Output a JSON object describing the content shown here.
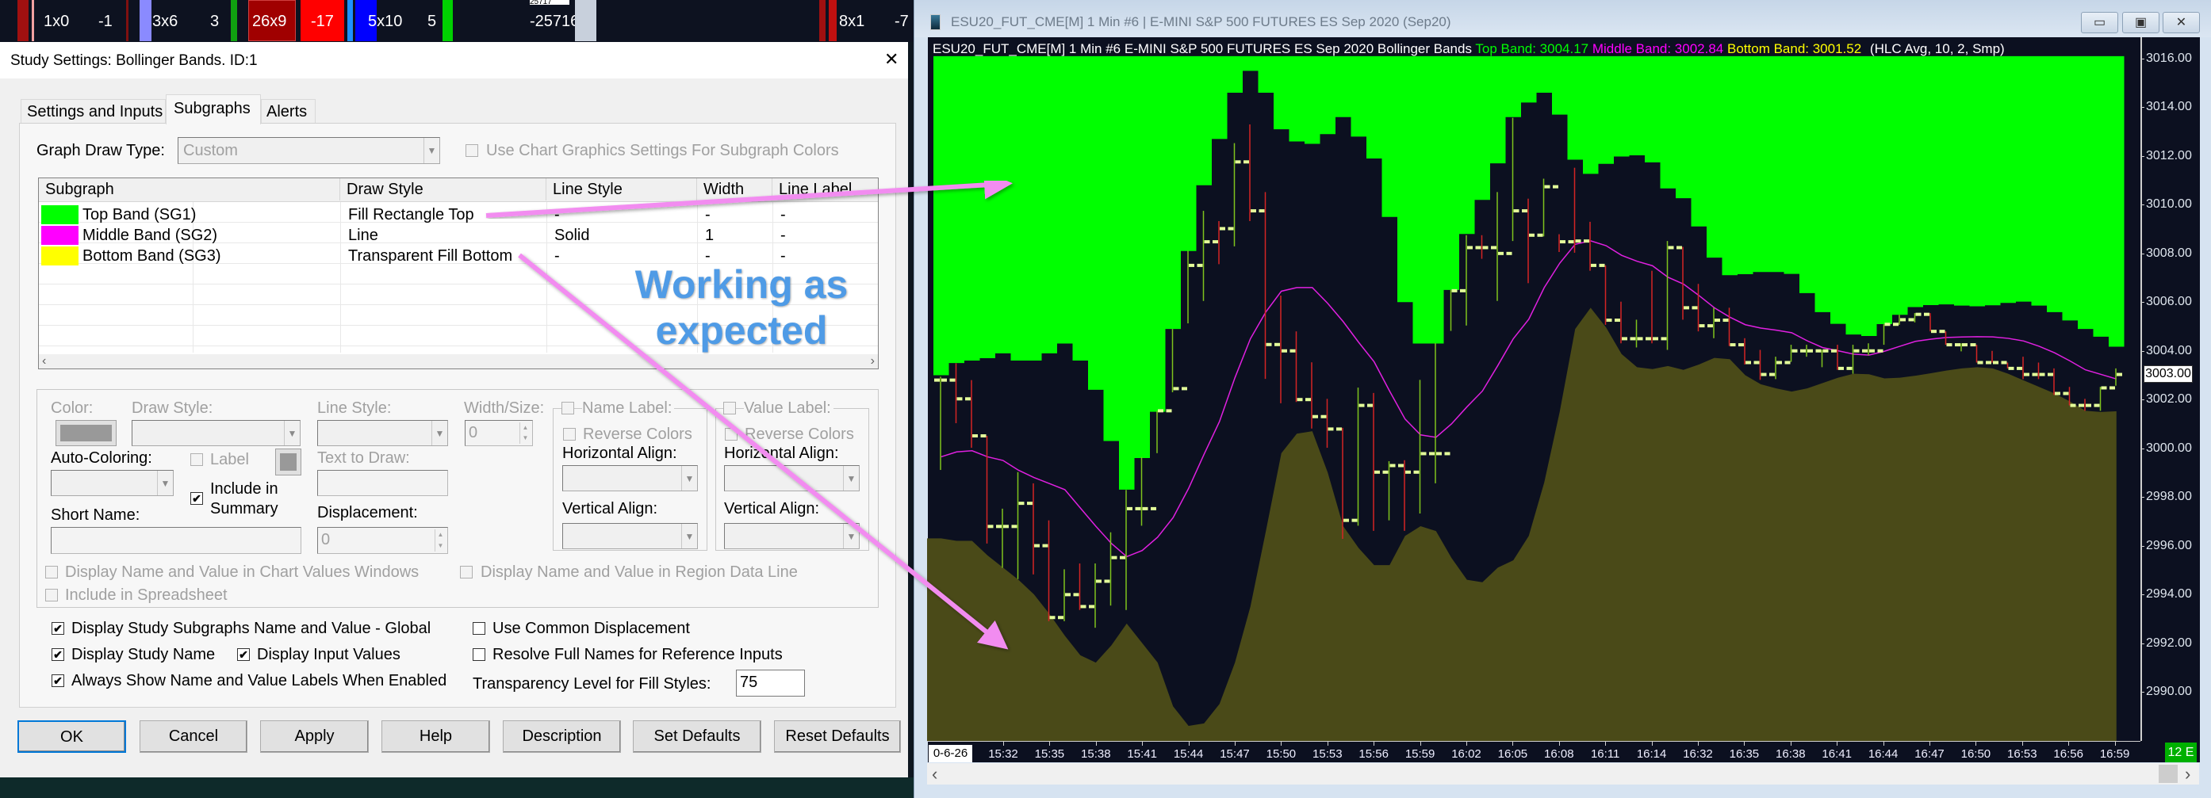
{
  "ticker_strip": {
    "cells": [
      "1x0",
      "-1",
      "3x6",
      "3",
      "26x9",
      "-17",
      "5x10",
      "5",
      "25717",
      "-25716",
      "8x1",
      "-7"
    ]
  },
  "dialog": {
    "title": "Study Settings: Bollinger Bands. ID:1",
    "close_label": "✕",
    "tabs": [
      {
        "label": "Settings and Inputs",
        "selected": false
      },
      {
        "label": "Subgraphs",
        "selected": true
      },
      {
        "label": "Alerts",
        "selected": false
      }
    ],
    "graph_draw_type_label": "Graph Draw Type:",
    "graph_draw_type_value": "Custom",
    "use_chart_graphics_label": "Use Chart Graphics Settings For Subgraph Colors",
    "use_chart_graphics_checked": false,
    "table": {
      "columns": [
        "Subgraph",
        "Draw Style",
        "Line Style",
        "Width",
        "Line Label"
      ],
      "rows": [
        {
          "color": "#00ff00",
          "name": "Top Band (SG1)",
          "draw_style": "Fill Rectangle Top",
          "line_style": "-",
          "width": "-",
          "line_label": "-"
        },
        {
          "color": "#ff00ff",
          "name": "Middle Band (SG2)",
          "draw_style": "Line",
          "line_style": "Solid",
          "width": "1",
          "line_label": "-"
        },
        {
          "color": "#ffff00",
          "name": "Bottom Band (SG3)",
          "draw_style": "Transparent Fill Bottom",
          "line_style": "-",
          "width": "-",
          "line_label": "-"
        }
      ]
    },
    "props": {
      "color_label": "Color:",
      "draw_style_label": "Draw Style:",
      "line_style_label": "Line Style:",
      "width_size_label": "Width/Size:",
      "width_size_value": "0",
      "name_label_label": "Name Label:",
      "value_label_label": "Value Label:",
      "reverse_colors_label": "Reverse Colors",
      "horizontal_align_label": "Horizontal Align:",
      "vertical_align_label": "Vertical Align:",
      "auto_coloring_label": "Auto-Coloring:",
      "label_label": "Label",
      "include_in_summary_line1": "Include in",
      "include_in_summary_line2": "Summary",
      "include_in_summary_checked": true,
      "text_to_draw_label": "Text to Draw:",
      "short_name_label": "Short Name:",
      "displacement_label": "Displacement:",
      "displacement_value": "0",
      "display_in_chart_values_label": "Display Name and Value in Chart Values Windows",
      "display_in_region_label": "Display Name and Value in Region Data Line",
      "include_in_spreadsheet_label": "Include in Spreadsheet"
    },
    "options": {
      "display_subgraphs_global": {
        "label": "Display Study Subgraphs Name and Value - Global",
        "checked": true
      },
      "display_study_name": {
        "label": "Display Study Name",
        "checked": true
      },
      "display_input_values": {
        "label": "Display Input Values",
        "checked": true
      },
      "always_show_labels": {
        "label": "Always Show Name and Value Labels When Enabled",
        "checked": true
      },
      "use_common_displacement": {
        "label": "Use Common Displacement",
        "checked": false
      },
      "resolve_full_names": {
        "label": "Resolve Full Names for Reference Inputs",
        "checked": false
      },
      "transparency_label": "Transparency Level for Fill Styles:",
      "transparency_value": "75"
    },
    "buttons": {
      "ok": "OK",
      "cancel": "Cancel",
      "apply": "Apply",
      "help": "Help",
      "description": "Description",
      "set_defaults": "Set Defaults",
      "reset_defaults": "Reset Defaults"
    }
  },
  "chart_window": {
    "title": "ESU20_FUT_CME[M]  1 Min  #6 | E-MINI S&P 500 FUTURES ES Sep 2020 (Sep20)",
    "header_main": "ESU20_FUT_CME[M]  1 Min  #6 E-MINI S&P 500 FUTURES ES Sep 2020 Bollinger Bands",
    "header_top": "Top Band: 3004.17",
    "header_middle": "Middle Band: 3002.84",
    "header_bottom": "Bottom Band: 3001.52",
    "header_params": "(HLC Avg, 10, 2, Smp)",
    "current_price": "3003.00",
    "date_label": "0-6-26",
    "status_badge": "12 E",
    "colors": {
      "background": "#0c1020",
      "top_fill": "#00ff00",
      "middle_line": "#e020e0",
      "bottom_fill": "#4a4a18",
      "up_bar": "#7fc31c",
      "down_bar": "#d42424",
      "tick": "#e4ff9a"
    }
  },
  "annotation": {
    "line1": "Working as",
    "line2": "expected"
  },
  "chart": {
    "ylim": [
      2987.5,
      3016.1
    ],
    "y_ticks": [
      "3016.00",
      "3014.00",
      "3012.00",
      "3010.00",
      "3008.00",
      "3006.00",
      "3004.00",
      "3002.00",
      "3000.00",
      "2998.00",
      "2996.00",
      "2994.00",
      "2992.00",
      "2990.00"
    ],
    "x_labels": [
      "15:32",
      "15:35",
      "15:38",
      "15:41",
      "15:44",
      "15:47",
      "15:50",
      "15:53",
      "15:56",
      "15:59",
      "16:02",
      "16:05",
      "16:08",
      "16:11",
      "16:14",
      "16:32",
      "16:35",
      "16:38",
      "16:41",
      "16:44",
      "16:47",
      "16:50",
      "16:53",
      "16:56",
      "16:59"
    ],
    "top_band": [
      3003.0,
      3003.5,
      3003.6,
      3003.7,
      3003.9,
      3003.6,
      3003.6,
      3003.9,
      3004.3,
      3003.6,
      3002.4,
      3000.3,
      2998.3,
      2999.6,
      3001.5,
      3004.9,
      3008.1,
      3010.8,
      3012.7,
      3014.6,
      3015.5,
      3014.6,
      3013.1,
      3012.6,
      3012.5,
      3012.9,
      3013.6,
      3012.8,
      3011.9,
      3009.5,
      3006.0,
      3004.3,
      3004.3,
      3006.5,
      3008.8,
      3010.2,
      3011.7,
      3013.6,
      3014.2,
      3014.6,
      3013.7,
      3011.85,
      3011.27,
      3011.68,
      3011.98,
      3012.03,
      3011.74,
      3010.67,
      3010.27,
      3009.11,
      3007.83,
      3007.11,
      3007.15,
      3007.24,
      3007.24,
      3007.16,
      3006.37,
      3005.59,
      3005.11,
      3004.67,
      3004.61,
      3005.1,
      3005.48,
      3005.8,
      3005.88,
      3005.91,
      3005.86,
      3005.83,
      3005.87,
      3005.97,
      3006.02,
      3005.86,
      3005.59,
      3005.25,
      3004.9,
      3004.58,
      3004.17
    ],
    "bottom_band": [
      2996.3,
      2996.2,
      2996.2,
      2995.6,
      2995.1,
      2994.6,
      2994.0,
      2993.2,
      2992.3,
      2991.5,
      2991.2,
      2991.9,
      2992.8,
      2992.0,
      2991.2,
      2989.4,
      2988.6,
      2988.7,
      2989.5,
      2991.2,
      2993.5,
      2996.6,
      2999.8,
      3000.6,
      3000.7,
      2999.0,
      2996.8,
      2995.9,
      2995.2,
      2995.2,
      2996.4,
      2996.8,
      2996.6,
      2995.5,
      2994.6,
      2994.5,
      2995.1,
      2995.4,
      2996.4,
      2998.6,
      3001.5,
      3004.9,
      3005.77,
      3004.96,
      3003.87,
      3003.33,
      3003.25,
      3003.38,
      3003.22,
      3003.44,
      3003.71,
      3003.66,
      3003.0,
      3002.63,
      3002.46,
      3002.33,
      3002.46,
      3002.68,
      3002.9,
      3003.06,
      3003.04,
      3002.87,
      3002.9,
      3002.98,
      3003.08,
      3003.19,
      3003.28,
      3003.33,
      3003.28,
      3003.06,
      3002.79,
      3002.52,
      3002.25,
      3001.92,
      3001.54,
      3001.49,
      3001.52
    ],
    "bars_hlc_dir": [
      [
        3002.94,
        2999.11,
        3002.8,
        1
      ],
      [
        3003.49,
        3001.03,
        3002.03,
        -1
      ],
      [
        3002.8,
        3000.02,
        3000.51,
        -1
      ],
      [
        3000.51,
        2996.09,
        2996.79,
        -1
      ],
      [
        2997.52,
        2995.09,
        2996.79,
        1
      ],
      [
        2999.02,
        2994.63,
        2997.74,
        1
      ],
      [
        2998.56,
        2994.82,
        2996.0,
        -1
      ],
      [
        2997.04,
        2992.9,
        2993.05,
        -1
      ],
      [
        2995.03,
        2992.9,
        2993.99,
        1
      ],
      [
        2995.27,
        2993.36,
        2993.5,
        -1
      ],
      [
        2995.27,
        2992.63,
        2994.54,
        1
      ],
      [
        2996.55,
        2993.54,
        2995.51,
        1
      ],
      [
        2998.29,
        2993.36,
        2997.52,
        1
      ],
      [
        2999.64,
        2996.82,
        2997.52,
        1
      ],
      [
        3001.54,
        2999.8,
        3001.54,
        1
      ],
      [
        3004.9,
        3002.3,
        3002.45,
        1
      ],
      [
        3008.11,
        3005.13,
        3007.51,
        1
      ],
      [
        3009.75,
        3006.05,
        3008.48,
        1
      ],
      [
        3009.33,
        3007.56,
        3009.02,
        -1
      ],
      [
        3012.53,
        3008.29,
        3011.76,
        1
      ],
      [
        3013.3,
        3009.33,
        3009.75,
        -1
      ],
      [
        3010.52,
        3002.85,
        3004.26,
        -1
      ],
      [
        3006.27,
        3001.85,
        3004.0,
        -1
      ],
      [
        3004.8,
        3001.9,
        3002.0,
        -1
      ],
      [
        3003.53,
        3000.81,
        3001.3,
        -1
      ],
      [
        3002.03,
        3000.02,
        3000.79,
        -1
      ],
      [
        3000.84,
        2996.28,
        2997.04,
        -1
      ],
      [
        3002.49,
        2996.82,
        3001.76,
        1
      ],
      [
        3002.27,
        2996.61,
        2999.02,
        -1
      ],
      [
        2999.47,
        2997.04,
        2999.29,
        1
      ],
      [
        2999.51,
        2996.61,
        2999.02,
        -1
      ],
      [
        3002.81,
        2997.32,
        2999.78,
        1
      ],
      [
        3004.31,
        2998.56,
        2999.78,
        1
      ],
      [
        3006.5,
        3004.82,
        3006.47,
        1
      ],
      [
        3008.75,
        3005.04,
        3008.24,
        1
      ],
      [
        3008.75,
        3007.78,
        3008.24,
        -1
      ],
      [
        3010.52,
        3006.05,
        3008.0,
        1
      ],
      [
        3013.57,
        3008.51,
        3009.75,
        1
      ],
      [
        3010.25,
        3006.78,
        3008.75,
        -1
      ],
      [
        3011.07,
        3008.7,
        3010.74,
        1
      ],
      [
        3008.79,
        3008.06,
        3008.48,
        -1
      ],
      [
        3011.52,
        3008.03,
        3008.51,
        -1
      ],
      [
        3009.3,
        3007.29,
        3007.51,
        -1
      ],
      [
        3007.51,
        3005.07,
        3005.26,
        -1
      ],
      [
        3006.02,
        3004.31,
        3004.5,
        -1
      ],
      [
        3005.28,
        3004.14,
        3004.5,
        1
      ],
      [
        3007.29,
        3004.31,
        3004.5,
        -1
      ],
      [
        3008.51,
        3004.04,
        3008.24,
        1
      ],
      [
        3008.27,
        3005.28,
        3005.77,
        -1
      ],
      [
        3006.75,
        3004.8,
        3005.03,
        -1
      ],
      [
        3005.77,
        3004.52,
        3005.26,
        1
      ],
      [
        3005.77,
        3004.2,
        3004.25,
        -1
      ],
      [
        3004.52,
        3003.44,
        3003.52,
        -1
      ],
      [
        3004.04,
        3002.81,
        3003.03,
        -1
      ],
      [
        3003.76,
        3002.84,
        3003.52,
        1
      ],
      [
        3004.25,
        3003.55,
        3004.0,
        1
      ],
      [
        3004.25,
        3003.76,
        3004.0,
        1
      ],
      [
        3004.04,
        3003.33,
        3004.0,
        1
      ],
      [
        3004.25,
        3003.22,
        3003.28,
        -1
      ],
      [
        3004.25,
        3003.06,
        3004.0,
        1
      ],
      [
        3004.31,
        3003.82,
        3004.0,
        1
      ],
      [
        3005.09,
        3004.25,
        3005.09,
        1
      ],
      [
        3005.48,
        3005.07,
        3005.28,
        1
      ],
      [
        3005.55,
        3005.17,
        3005.5,
        1
      ],
      [
        3005.55,
        3004.8,
        3004.8,
        -1
      ],
      [
        3004.8,
        3004.25,
        3004.25,
        -1
      ],
      [
        3004.31,
        3003.98,
        3004.25,
        1
      ],
      [
        3004.25,
        3003.52,
        3003.52,
        -1
      ],
      [
        3004.0,
        3003.52,
        3003.52,
        -1
      ],
      [
        3003.52,
        3003.28,
        3003.28,
        -1
      ],
      [
        3003.76,
        3002.84,
        3003.03,
        -1
      ],
      [
        3003.52,
        3002.84,
        3003.03,
        -1
      ],
      [
        3003.28,
        3002.19,
        3002.25,
        -1
      ],
      [
        3002.52,
        3001.76,
        3001.76,
        -1
      ],
      [
        3002.03,
        3001.54,
        3001.76,
        -1
      ],
      [
        3002.52,
        3001.54,
        3002.48,
        1
      ],
      [
        3003.28,
        3002.57,
        3003.03,
        1
      ]
    ]
  }
}
